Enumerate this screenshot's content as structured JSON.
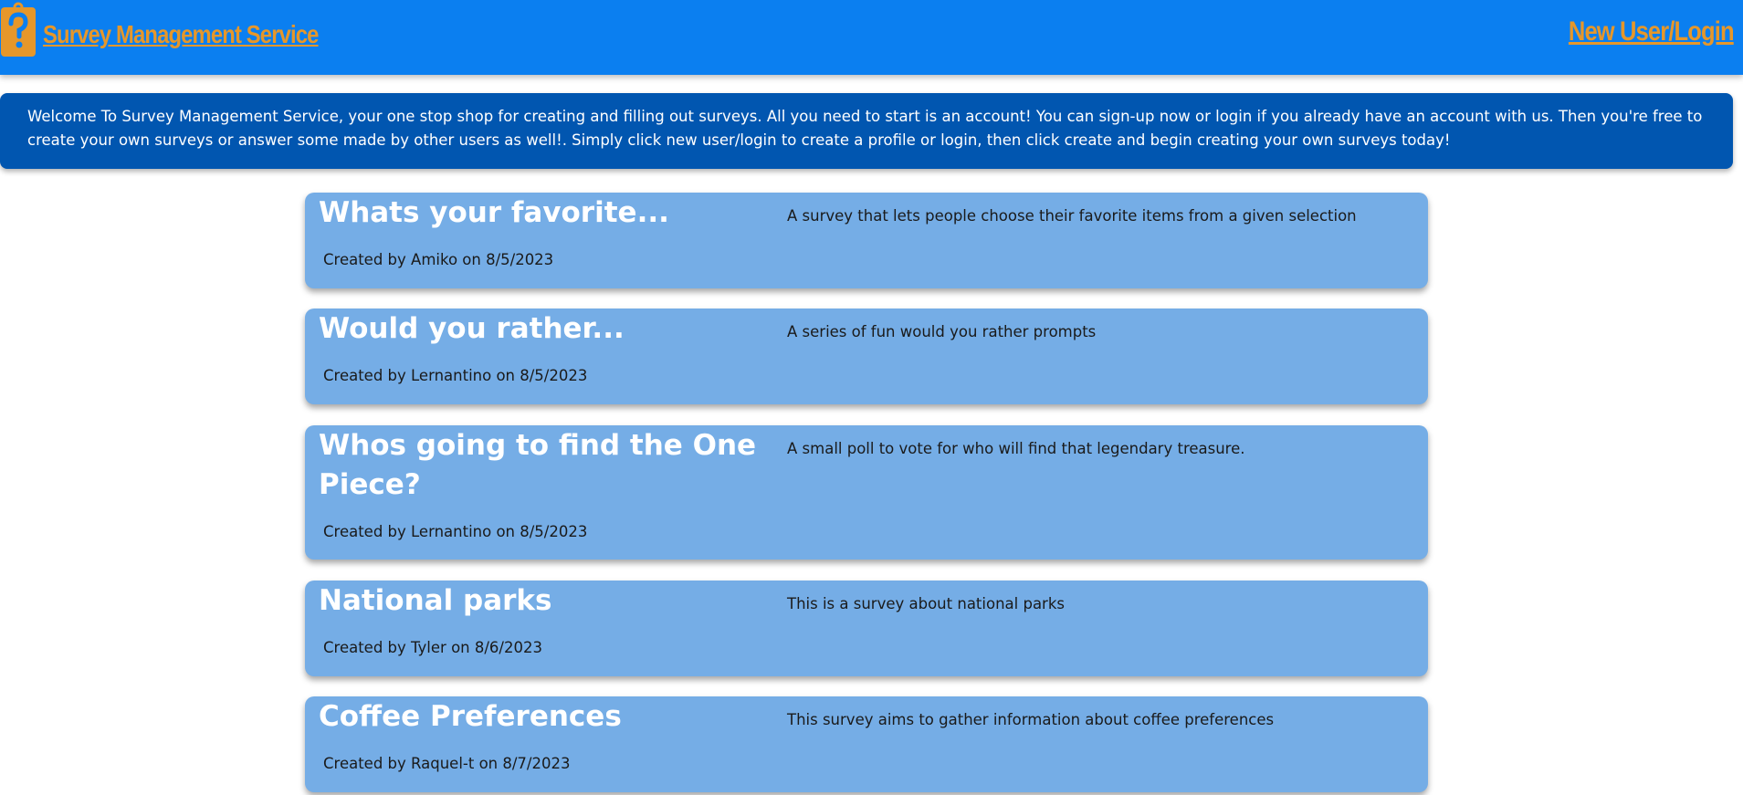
{
  "header": {
    "brand": "Survey Management Service",
    "login_link": "New User/Login"
  },
  "welcome": {
    "text": "Welcome To Survey Management Service, your one stop shop for creating and filling out surveys. All you need to start is an account! You can sign-up now or login if you already have an account with us. Then you're free to create your own surveys or answer some made by other users as well!. Simply click new user/login to create a profile or login, then click create and begin creating your own surveys today!"
  },
  "surveys": [
    {
      "title": "Whats your favorite...",
      "description": "A survey that lets people choose their favorite items from a given selection",
      "meta": "Created by Amiko on 8/5/2023"
    },
    {
      "title": "Would you rather...",
      "description": "A series of fun would you rather prompts",
      "meta": "Created by Lernantino on 8/5/2023"
    },
    {
      "title": "Whos going to find the One Piece?",
      "description": "A small poll to vote for who will find that legendary treasure.",
      "meta": "Created by Lernantino on 8/5/2023"
    },
    {
      "title": "National parks",
      "description": "This is a survey about national parks",
      "meta": "Created by Tyler on 8/6/2023"
    },
    {
      "title": "Coffee Preferences",
      "description": "This survey aims to gather information about coffee preferences",
      "meta": "Created by Raquel-t on 8/7/2023"
    }
  ],
  "colors": {
    "header_bg": "#0b7ff0",
    "accent": "#e6972a",
    "welcome_bg": "#0156b0",
    "card_bg": "#75ade6"
  },
  "icons": {
    "logo": "question-tag-icon"
  }
}
